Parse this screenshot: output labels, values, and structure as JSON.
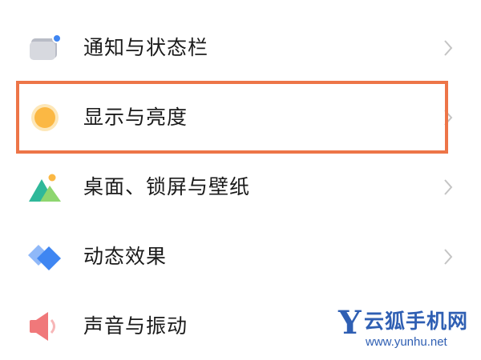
{
  "settings": {
    "items": [
      {
        "label": "通知与状态栏",
        "icon": "notification-panel-icon"
      },
      {
        "label": "显示与亮度",
        "icon": "sun-icon"
      },
      {
        "label": "桌面、锁屏与壁纸",
        "icon": "wallpaper-mountain-icon"
      },
      {
        "label": "动态效果",
        "icon": "diamond-layers-icon"
      },
      {
        "label": "声音与振动",
        "icon": "speaker-icon"
      }
    ]
  },
  "highlight": {
    "item_index": 1,
    "color": "#ed7548"
  },
  "watermark": {
    "logo_letter": "Y",
    "name": "云狐手机网",
    "url": "www.yunhu.net",
    "color": "#2f5fb3"
  },
  "colors": {
    "text": "#1a1a1a",
    "chevron": "#c4c4c4",
    "sun": "#fbb844",
    "mountain_green": "#2fb89a",
    "diamond_blue": "#3f86f2",
    "speaker_red": "#f0787a"
  }
}
